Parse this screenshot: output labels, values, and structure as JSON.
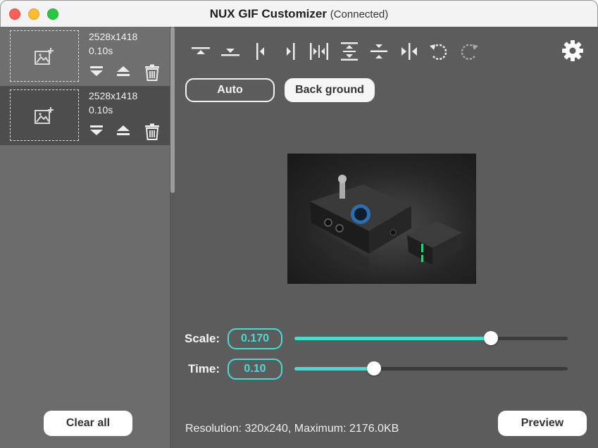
{
  "window": {
    "app_name": "NUX GIF Customizer",
    "status": "(Connected)"
  },
  "frames": [
    {
      "resolution": "2528x1418",
      "duration": "0.10s"
    },
    {
      "resolution": "2528x1418",
      "duration": "0.10s"
    }
  ],
  "sidebar": {
    "clear_all_label": "Clear all"
  },
  "toolbar": {
    "icons": [
      "align-top-icon",
      "align-bottom-icon",
      "align-left-icon",
      "align-right-icon",
      "center-horizontal-icon",
      "stretch-vertical-icon",
      "center-vertical-icon",
      "flip-horizontal-icon",
      "rotate-left-icon",
      "rotate-right-icon"
    ],
    "settings_icon": "gear-icon"
  },
  "buttons": {
    "auto_label": "Auto",
    "background_label": "Back ground",
    "preview_label": "Preview"
  },
  "controls": {
    "scale": {
      "label": "Scale:",
      "value": "0.170",
      "fraction": 0.72
    },
    "time": {
      "label": "Time:",
      "value": "0.10",
      "fraction": 0.29
    }
  },
  "footer": {
    "resolution_text": "Resolution: 320x240, Maximum: 2176.0KB"
  },
  "colors": {
    "accent": "#45dcd6",
    "panel": "#5c5c5c",
    "sidebar": "#6c6c6c"
  }
}
